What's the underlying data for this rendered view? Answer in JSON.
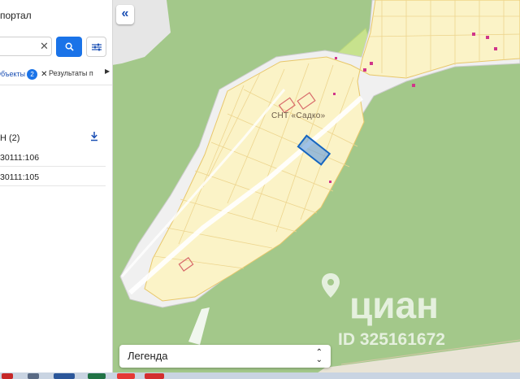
{
  "sidebar": {
    "title": "портал",
    "search": {
      "value": "",
      "placeholder": ""
    },
    "tabs": [
      {
        "label": "Объекты",
        "count": "2"
      },
      {
        "label": "Результаты п"
      }
    ],
    "group": {
      "label": "Н (2)"
    },
    "results": [
      {
        "label": "30111:106"
      },
      {
        "label": "30111:105"
      }
    ]
  },
  "map": {
    "place_label": "СНТ «Садко»",
    "legend_label": "Легенда",
    "watermark_logo": "циан",
    "watermark_id": "ID 325161672",
    "colors": {
      "forest": "#a3c88a",
      "parcels": "#fbf3c7",
      "parcel_border": "#e8c76a",
      "selected": "#1565c0",
      "accent": "#1a73e8"
    }
  },
  "taskbar": {
    "icons": [
      "opera-icon",
      "app-icon",
      "word-icon",
      "excel-icon",
      "chrome-icon",
      "yandex-icon"
    ]
  }
}
